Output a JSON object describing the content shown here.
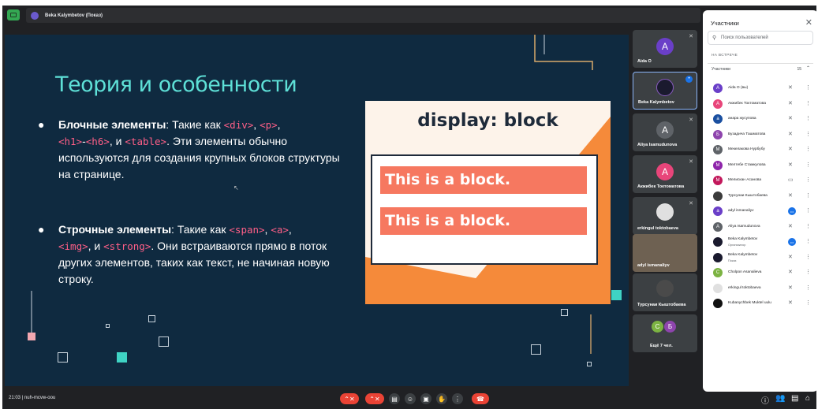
{
  "topbar": {
    "presenter": "Beka Kalymbetov (Показ)"
  },
  "slide": {
    "title": "Теория и особенности",
    "bullet1": {
      "strong": "Блочные элементы",
      "t1": ": Такие как ",
      "c1": "<div>",
      "t2": ", ",
      "c2": "<p>",
      "t3": ",",
      "c3": "<h1>",
      "t4": "-",
      "c4": "<h6>",
      "t5": ", и ",
      "c5": "<table>",
      "t6": ". Эти элементы обычно используются для создания крупных блоков структуры на странице."
    },
    "bullet2": {
      "strong": "Строчные элементы",
      "t1": ": Такие как ",
      "c1": "<span>",
      "t2": ", ",
      "c2": "<a>",
      "t3": ",",
      "c3": "<img>",
      "t4": ", и ",
      "c4": "<strong>",
      "t5": ". Они встраиваются прямо в поток других элементов, таких как текст, не начиная новую строку."
    },
    "demo": {
      "title": "display: block",
      "block1": "This is a block.",
      "block2": "This is a block."
    }
  },
  "tiles": [
    {
      "name": "Aida O",
      "initial": "A",
      "color": "#6a3fc8"
    },
    {
      "name": "Beka Kalymbetov",
      "initial": "",
      "color": "#1a1a2e"
    },
    {
      "name": "Aliya Isamudunova",
      "initial": "A",
      "color": "#5f6368"
    },
    {
      "name": "Акжибек Токтоматова",
      "initial": "A",
      "color": "#e8457a"
    },
    {
      "name": "erkingul toktobaeva",
      "initial": "",
      "color": "#e0e0e0"
    },
    {
      "name": "adyl ismanaliyv",
      "initial": "",
      "color": "#7a6a55"
    },
    {
      "name": "Турсунаи Кыштобаева",
      "initial": "",
      "color": "#4a4a4a"
    },
    {
      "name": "Ещё 7 чел.",
      "initial": "",
      "color": ""
    }
  ],
  "more_tile": {
    "c1": "C",
    "c2": "Б",
    "label": "Ещё 7 чел."
  },
  "bottombar": {
    "time": "21:03",
    "code": "nuh-mcvw-oou"
  },
  "panel": {
    "title": "Участники",
    "search_placeholder": "Поиск пользователей",
    "section": "НА ВСТРЕЧЕ",
    "group": "Участники",
    "count": "15",
    "people": [
      {
        "name": "Aida O (вы)",
        "initial": "A",
        "color": "#6a3fc8",
        "mic": "muted"
      },
      {
        "name": "Акжибек Токтоматова",
        "initial": "A",
        "color": "#e8457a",
        "mic": "muted"
      },
      {
        "name": "анара жусупова",
        "initial": "а",
        "color": "#1a4fa0",
        "mic": "muted"
      },
      {
        "name": "Бузадича Ташматова",
        "initial": "Б",
        "color": "#8e44ad",
        "mic": "muted"
      },
      {
        "name": "Мекелакова Нурбубу",
        "initial": "М",
        "color": "#5f6368",
        "mic": "muted"
      },
      {
        "name": "Мелтебе Стамкулова",
        "initial": "М",
        "color": "#8e24aa",
        "mic": "muted"
      },
      {
        "name": "Мелискан Асанова",
        "initial": "М",
        "color": "#c2185b",
        "mic": "present"
      },
      {
        "name": "Турсунаи Кыштобаева",
        "initial": "",
        "color": "#3b3b3b",
        "mic": "muted"
      },
      {
        "name": "adyl ismanaliyv",
        "initial": "a",
        "color": "#6a3fc8",
        "mic": "active"
      },
      {
        "name": "Aliya Isamudunova",
        "initial": "A",
        "color": "#5f6368",
        "mic": "muted"
      },
      {
        "name": "Beka Kalymbetov",
        "sub": "Организатор",
        "initial": "",
        "color": "#1a1a2e",
        "mic": "active"
      },
      {
        "name": "Beka Kalymbetov",
        "sub": "Показ",
        "initial": "",
        "color": "#1a1a2e",
        "mic": "muted"
      },
      {
        "name": "Cholpon Asanalieva",
        "initial": "C",
        "color": "#7cb342",
        "mic": "muted"
      },
      {
        "name": "erkingul toktobaeva",
        "initial": "",
        "color": "#e0e0e0",
        "mic": "muted"
      },
      {
        "name": "Kubanychbek Muktel uulu",
        "initial": "",
        "color": "#111111",
        "mic": "muted"
      }
    ]
  }
}
